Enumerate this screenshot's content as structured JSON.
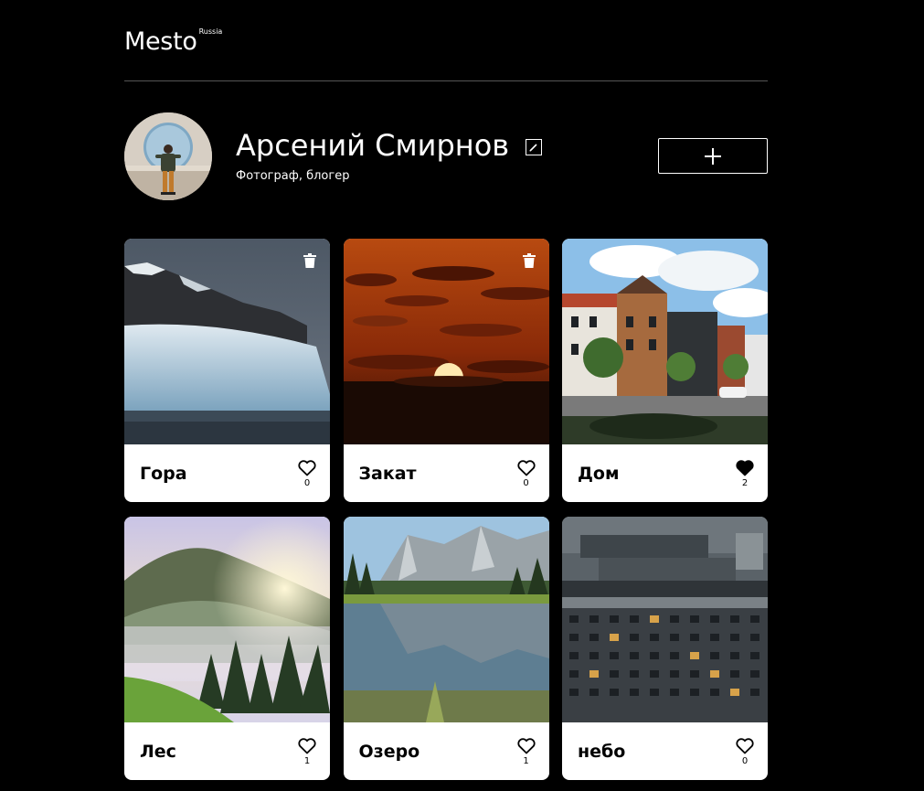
{
  "header": {
    "logo": "Mesto",
    "logo_sup": "Russia"
  },
  "profile": {
    "name": "Арсений Смирнов",
    "about": "Фотограф, блогер"
  },
  "colors": {
    "background": "#000000",
    "text": "#ffffff",
    "divider": "#545454",
    "card": "#ffffff"
  },
  "cards": [
    {
      "title": "Гора",
      "likes": "0",
      "liked": false,
      "deletable": true,
      "icon": "heart-outline-icon"
    },
    {
      "title": "Закат",
      "likes": "0",
      "liked": false,
      "deletable": true,
      "icon": "heart-outline-icon"
    },
    {
      "title": "Дом",
      "likes": "2",
      "liked": true,
      "deletable": false,
      "icon": "heart-filled-icon"
    },
    {
      "title": "Лес",
      "likes": "1",
      "liked": false,
      "deletable": false,
      "icon": "heart-outline-icon"
    },
    {
      "title": "Озеро",
      "likes": "1",
      "liked": false,
      "deletable": false,
      "icon": "heart-outline-icon"
    },
    {
      "title": "небо",
      "likes": "0",
      "liked": false,
      "deletable": false,
      "icon": "heart-outline-icon"
    }
  ]
}
